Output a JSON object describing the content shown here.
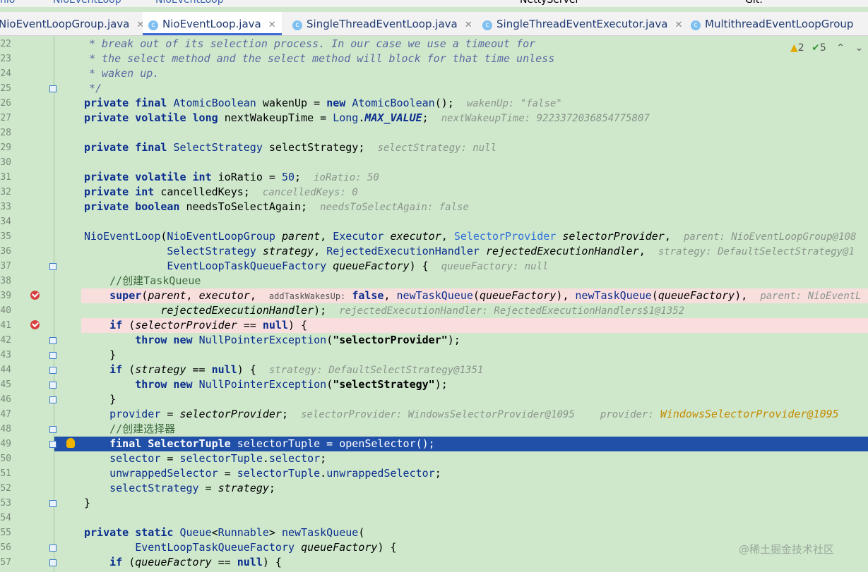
{
  "breadcrumb": {
    "items": [
      "nio",
      "NioEventLoop",
      "NioEventLoop"
    ]
  },
  "run_config": "NettyServer",
  "vcs_label": "Git:",
  "tabs": [
    {
      "label": "NioEventLoopGroup.java",
      "active": false
    },
    {
      "label": "NioEventLoop.java",
      "active": true
    },
    {
      "label": "SingleThreadEventLoop.java",
      "active": false
    },
    {
      "label": "SingleThreadEventExecutor.java",
      "active": false
    },
    {
      "label": "MultithreadEventLoopGroup",
      "active": false
    }
  ],
  "inspections": {
    "warnings": "2",
    "ok": "5"
  },
  "line_numbers": [
    "22",
    "23",
    "24",
    "25",
    "26",
    "27",
    "28",
    "29",
    "30",
    "31",
    "32",
    "33",
    "34",
    "35",
    "36",
    "37",
    "38",
    "39",
    "40",
    "41",
    "42",
    "43",
    "44",
    "45",
    "46",
    "47",
    "48",
    "49",
    "50",
    "51",
    "52",
    "53",
    "54",
    "55",
    "56",
    "57"
  ],
  "code": {
    "l22": "* break out of its selection process. In our case we use a timeout for",
    "l23": "* the select method and the select method will block for that time unless",
    "l24": "* waken up.",
    "l25": "*/",
    "l26_hint": "wakenUp: \"false\"",
    "l27_hint": "nextWakeupTime: 9223372036854775807",
    "l29_hint": "selectStrategy: null",
    "l31_hint": "ioRatio: 50",
    "l32_hint": "cancelledKeys: 0",
    "l33_hint": "needsToSelectAgain: false",
    "l35_hint": "parent: NioEventLoopGroup@108",
    "l36_hint": "strategy: DefaultSelectStrategy@1",
    "l37_hint": "queueFactory: null",
    "l38": "//创建TaskQueue",
    "l39_param": "addTaskWakesUp:",
    "l39_hint": "parent: NioEventL",
    "l40_hint": "rejectedExecutionHandler: RejectedExecutionHandlers$1@1352",
    "l44_hint": "strategy: DefaultSelectStrategy@1351",
    "l47_hint1": "selectorProvider: WindowsSelectorProvider@1095",
    "l47_hint2": "provider:",
    "l47_hint3": "WindowsSelectorProvider@1095",
    "l48": "//创建选择器",
    "str1": "\"selectorProvider\"",
    "str2": "\"selectStrategy\""
  },
  "watermark": "@稀土掘金技术社区",
  "colors": {
    "editor_bg": "#cfe8cc",
    "current_line": "#2150a8",
    "breakpoint_line": "#f9dede",
    "breakpoint": "#d84040"
  }
}
